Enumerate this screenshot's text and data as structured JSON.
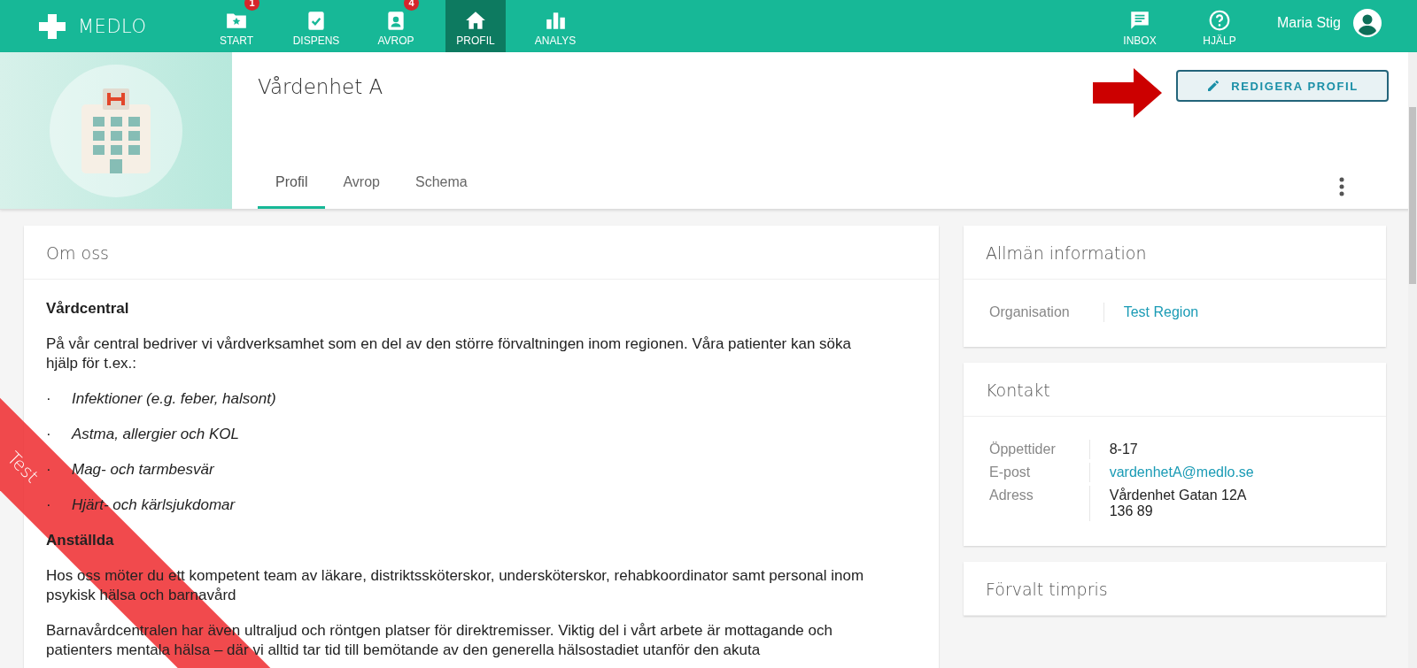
{
  "app": {
    "logo": "MEDLO"
  },
  "nav": [
    {
      "label": "START",
      "badge": "1",
      "selected": false
    },
    {
      "label": "DISPENS",
      "selected": false
    },
    {
      "label": "AVROP",
      "badge": "4",
      "selected": false
    },
    {
      "label": "PROFIL",
      "selected": true
    },
    {
      "label": "ANALYS",
      "selected": false
    }
  ],
  "nav_right": [
    {
      "label": "INBOX"
    },
    {
      "label": "HJÄLP"
    }
  ],
  "user": {
    "name": "Maria Stig"
  },
  "profile": {
    "title": "Vårdenhet A",
    "edit_button": "REDIGERA PROFIL",
    "tabs": [
      {
        "label": "Profil",
        "selected": true
      },
      {
        "label": "Avrop",
        "selected": false
      },
      {
        "label": "Schema",
        "selected": false
      }
    ]
  },
  "about": {
    "title": "Om oss",
    "blocks": [
      {
        "kind": "heading",
        "text": "Vårdcentral"
      },
      {
        "kind": "paragraph",
        "text": "På vår central bedriver vi vårdverksamhet som en del av den större förvaltningen inom regionen. Våra patienter kan söka hjälp för t.ex.:"
      },
      {
        "kind": "bullet",
        "marker": "·",
        "text": "Infektioner (e.g. feber, halsont)"
      },
      {
        "kind": "bullet",
        "marker": "·",
        "text": "Astma, allergier och KOL"
      },
      {
        "kind": "bullet",
        "marker": "·",
        "text": "Mag- och tarmbesvär"
      },
      {
        "kind": "bullet",
        "marker": "·",
        "text": "Hjärt- och kärlsjukdomar"
      },
      {
        "kind": "heading",
        "text": "Anställda"
      },
      {
        "kind": "paragraph",
        "text": "Hos oss möter du ett kompetent team av läkare, distriktssköterskor, undersköterskor, rehabkoordinator samt personal inom psykisk hälsa och barnavård"
      },
      {
        "kind": "paragraph",
        "text": "Barnavårdcentralen har även ultraljud och röntgen platser för direktremisser. Viktig del i vårt arbete är mottagande och patienters mentala hälsa – där vi alltid tar tid till bemötande av den generella hälsostadiet utanför den akuta"
      }
    ]
  },
  "info_cards": [
    {
      "title": "Allmän information",
      "rows": [
        {
          "label": "Organisation",
          "kind": "link",
          "lines": [
            "Test Region"
          ]
        }
      ]
    },
    {
      "title": "Kontakt",
      "rows": [
        {
          "label": "Öppettider",
          "kind": "text",
          "lines": [
            "8-17"
          ]
        },
        {
          "label": "E-post",
          "kind": "link",
          "lines": [
            "vardenhetA@medlo.se"
          ]
        },
        {
          "label": "Adress",
          "kind": "text",
          "lines": [
            "Vårdenhet Gatan 12A",
            "136 89"
          ]
        }
      ]
    },
    {
      "title": "Förvalt timpris"
    }
  ],
  "ribbon": {
    "label": "Test"
  }
}
